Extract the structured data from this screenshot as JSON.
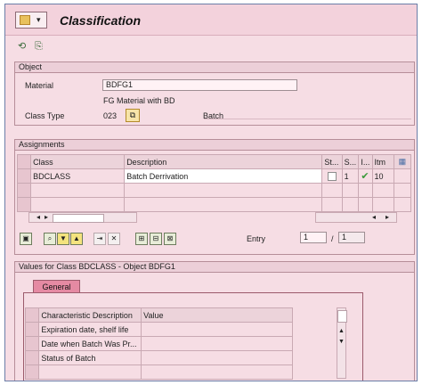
{
  "header": {
    "title": "Classification",
    "menu_icon": "sap-menu-icon",
    "toolbar_icons": [
      "display-document-icon",
      "other-document-icon"
    ]
  },
  "object": {
    "section_title": "Object",
    "material_label": "Material",
    "material_value": "BDFG1",
    "material_desc": "FG Material with BD",
    "class_type_label": "Class Type",
    "class_type_value": "023",
    "class_type_desc": "Batch"
  },
  "assignments": {
    "section_title": "Assignments",
    "columns": [
      "Class",
      "Description",
      "St...",
      "S...",
      "I...",
      "Itm"
    ],
    "rows": [
      {
        "class": "BDCLASS",
        "description": "Batch Derrivation",
        "st": "",
        "s": "1",
        "i": "✔",
        "itm": "10"
      }
    ],
    "entry_label": "Entry",
    "entry_value": "1",
    "entry_total": "1",
    "separator": "/"
  },
  "values": {
    "section_title": "Values for Class BDCLASS - Object BDFG1",
    "tab_label": "General",
    "columns": [
      "Characteristic Description",
      "Value"
    ],
    "rows": [
      {
        "char": "Expiration date, shelf life",
        "value": ""
      },
      {
        "char": "Date when Batch Was Pr...",
        "value": ""
      },
      {
        "char": "Status of Batch",
        "value": ""
      }
    ]
  }
}
